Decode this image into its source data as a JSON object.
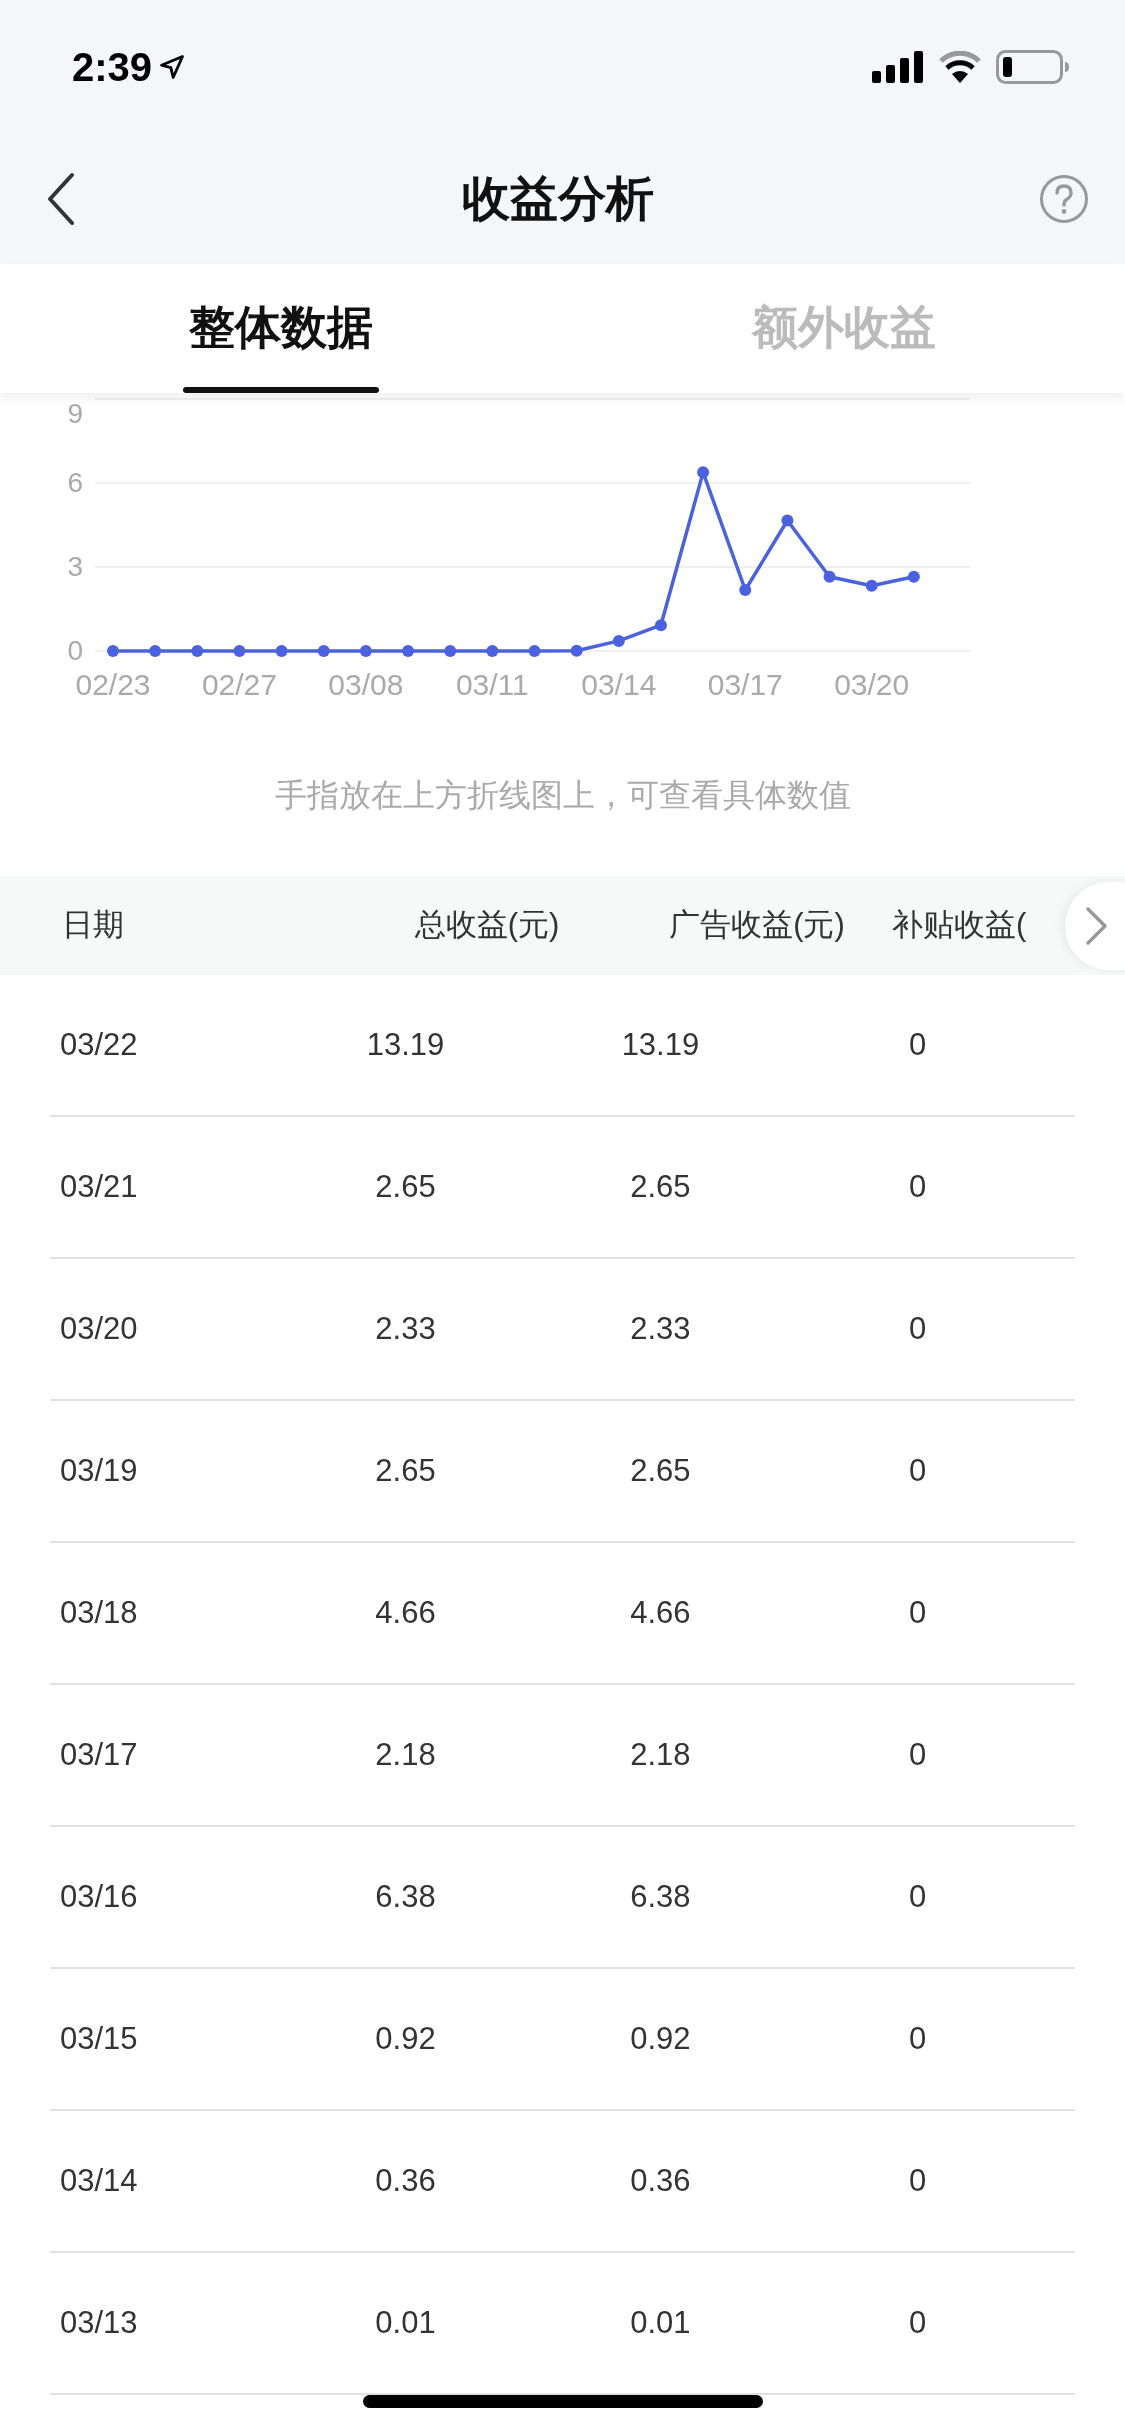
{
  "status_bar": {
    "time": "2:39"
  },
  "nav": {
    "title": "收益分析"
  },
  "tabs": [
    {
      "label": "整体数据",
      "selected": true
    },
    {
      "label": "额外收益",
      "selected": false
    }
  ],
  "chart": {
    "chart_data": {
      "type": "line",
      "categories": [
        "02/23",
        null,
        null,
        "02/27",
        null,
        null,
        "03/08",
        null,
        null,
        "03/11",
        null,
        null,
        "03/14",
        null,
        null,
        "03/17",
        null,
        null,
        "03/20",
        null,
        null
      ],
      "series": [
        {
          "color": "#4a62e0",
          "marker": "circle",
          "values": [
            0,
            0,
            0,
            0,
            0,
            0,
            0,
            0,
            0,
            0,
            0,
            0.01,
            0.36,
            0.92,
            6.38,
            2.18,
            4.66,
            2.65,
            2.33,
            2.65,
            null
          ]
        }
      ],
      "ylim": [
        0,
        9
      ],
      "yticks": [
        0,
        3,
        6,
        9
      ],
      "grid": true
    }
  },
  "hint": "手指放在上方折线图上，可查看具体数值",
  "table": {
    "columns": [
      "日期",
      "总收益(元)",
      "广告收益(元)",
      "补贴收益("
    ],
    "rows": [
      [
        "03/22",
        "13.19",
        "13.19",
        "0"
      ],
      [
        "03/21",
        "2.65",
        "2.65",
        "0"
      ],
      [
        "03/20",
        "2.33",
        "2.33",
        "0"
      ],
      [
        "03/19",
        "2.65",
        "2.65",
        "0"
      ],
      [
        "03/18",
        "4.66",
        "4.66",
        "0"
      ],
      [
        "03/17",
        "2.18",
        "2.18",
        "0"
      ],
      [
        "03/16",
        "6.38",
        "6.38",
        "0"
      ],
      [
        "03/15",
        "0.92",
        "0.92",
        "0"
      ],
      [
        "03/14",
        "0.36",
        "0.36",
        "0"
      ],
      [
        "03/13",
        "0.01",
        "0.01",
        "0"
      ]
    ]
  }
}
